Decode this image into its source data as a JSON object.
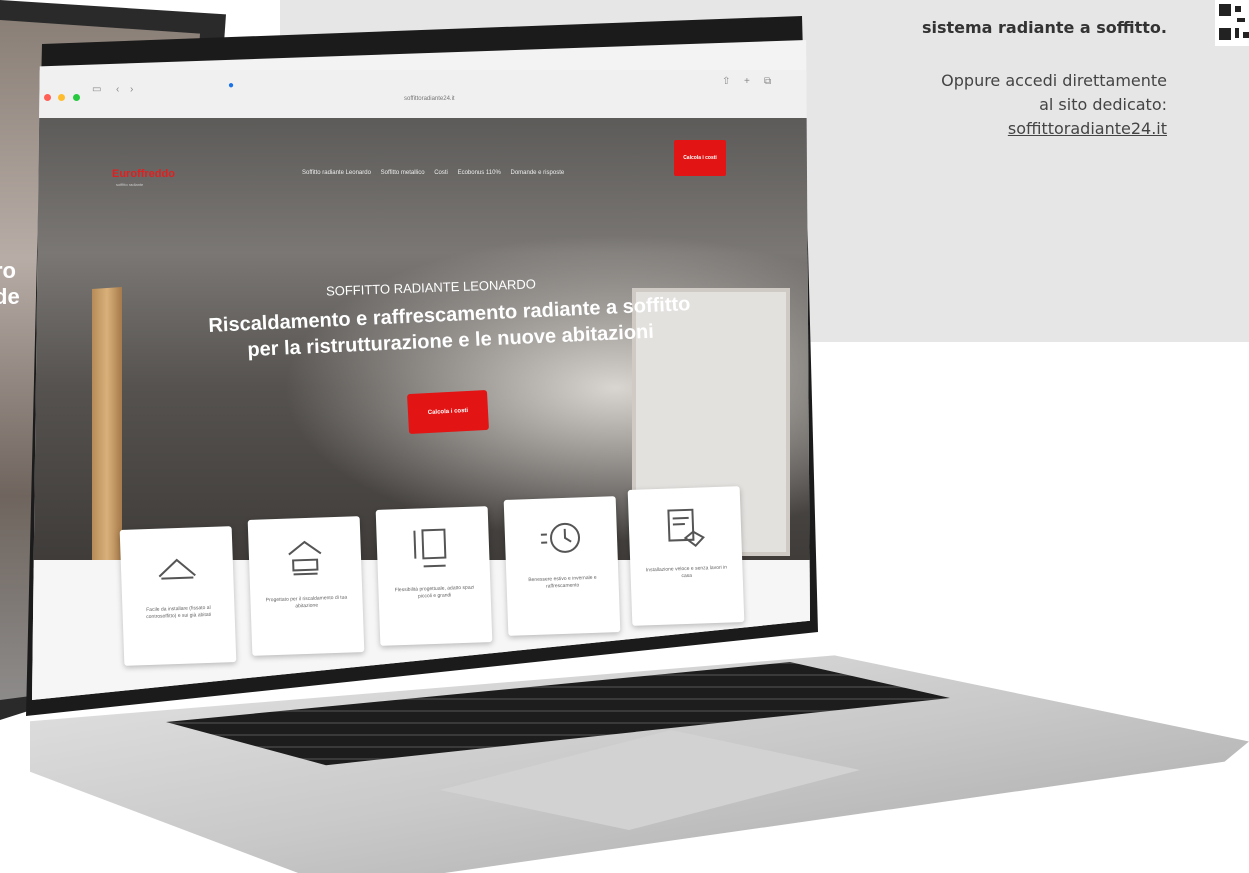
{
  "info": {
    "headline": "sistema radiante a soffitto.",
    "sub_line1": "Oppure accedi direttamente",
    "sub_line2": "al sito dedicato:",
    "link": "soffittoradiante24.it"
  },
  "back_laptop": {
    "line1": "ro",
    "line2": "de"
  },
  "browser": {
    "url": "soffittoradiante24.it"
  },
  "site": {
    "logo": "Euroffreddo",
    "logo_sub": "soffitto radiante",
    "nav": [
      "Soffitto radiante Leonardo",
      "Soffitto metallico",
      "Costi",
      "Ecobonus 110%",
      "Domande e risposte"
    ],
    "nav_cta": "Calcola i costi",
    "hero_kicker": "SOFFITTO RADIANTE LEONARDO",
    "hero_title_line1": "Riscaldamento e raffrescamento radiante a soffitto",
    "hero_title_line2": "per la ristrutturazione e le nuove abitazioni",
    "hero_cta": "Calcola i costi",
    "cards": [
      {
        "icon": "ceiling-icon",
        "label": "Facile da installare (fissato al controsoffitto) e sui già abitati"
      },
      {
        "icon": "bedroom-icon",
        "label": "Progettato per il riscaldamento di tua abitazione"
      },
      {
        "icon": "room-dimensions-icon",
        "label": "Flessibilità progettuale, adatto spazi piccoli e grandi"
      },
      {
        "icon": "clock-icon",
        "label": "Benessere estivo e invernale e raffrescamento"
      },
      {
        "icon": "handshake-document-icon",
        "label": "Installazione veloce e senza lavori in casa"
      }
    ]
  }
}
